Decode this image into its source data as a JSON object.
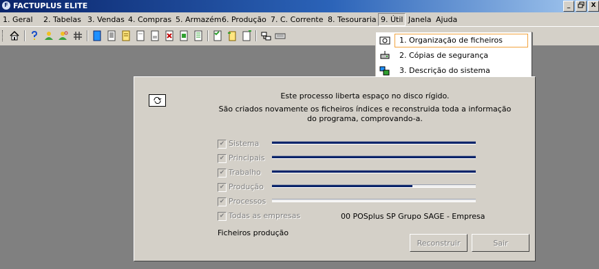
{
  "window": {
    "title": "FACTUPLUS ELITE",
    "icon": "app-logo-icon",
    "controls": {
      "minimize": "_",
      "restore": "🗗",
      "close": "X"
    }
  },
  "menubar": {
    "items": [
      {
        "label": "1. Geral"
      },
      {
        "label": "2. Tabelas"
      },
      {
        "label": "3. Vendas"
      },
      {
        "label": "4. Compras"
      },
      {
        "label": "5. Armazém"
      },
      {
        "label": "6. Produção"
      },
      {
        "label": "7. C. Corrente"
      },
      {
        "label": "8. Tesouraria"
      },
      {
        "label": "9. Útil"
      },
      {
        "label": "Janela"
      },
      {
        "label": "Ajuda"
      }
    ],
    "open_menu": "9. Útil"
  },
  "toolbar": {
    "icons": [
      "home-icon",
      "help-icon",
      "users-icon",
      "search-users-icon",
      "grid-icon",
      "blue-document-icon",
      "document-lines-icon",
      "yellow-document-icon",
      "blank-document-icon",
      "report-icon",
      "delete-document-icon",
      "green-document-icon",
      "list-document-icon",
      "tick-document-icon",
      "transfer-document-icon",
      "new-document-icon",
      "network-icon",
      "keyboard-icon"
    ]
  },
  "dropdown": {
    "items": [
      {
        "label": "1. Organização de ficheiros",
        "icon": "reorganize-icon",
        "highlighted": true
      },
      {
        "label": "2. Cópias de segurança",
        "icon": "backup-drive-icon",
        "highlighted": false
      },
      {
        "label": "3. Descrição do sistema",
        "icon": "system-info-icon",
        "highlighted": false
      }
    ]
  },
  "dialog": {
    "icon": "reorganize-icon",
    "intro_line1": "Este processo liberta espaço no disco rígido.",
    "intro_line2": "São criados novamente os ficheiros índices e reconstruida toda a informação do programa, comprovando-a.",
    "checkboxes": [
      {
        "label": "Sistema",
        "checked": true,
        "progress": 1.0
      },
      {
        "label": "Principais",
        "checked": true,
        "progress": 1.0
      },
      {
        "label": "Trabalho",
        "checked": true,
        "progress": 1.0
      },
      {
        "label": "Produção",
        "checked": true,
        "progress": 0.69
      },
      {
        "label": "Processos",
        "checked": true,
        "progress": 0.0
      },
      {
        "label": "Todas as empresas",
        "checked": true
      }
    ],
    "company": "00 POSplus SP Grupo SAGE - Empresa",
    "status": "Ficheiros produção",
    "buttons": {
      "rebuild": "Reconstruir",
      "exit": "Sair"
    }
  },
  "colors": {
    "titlebar": "#0a246a",
    "progress_fill": "#0a246a",
    "highlight_border": "#f2a23c",
    "face": "#d4d0c8",
    "desktop": "#808080"
  }
}
